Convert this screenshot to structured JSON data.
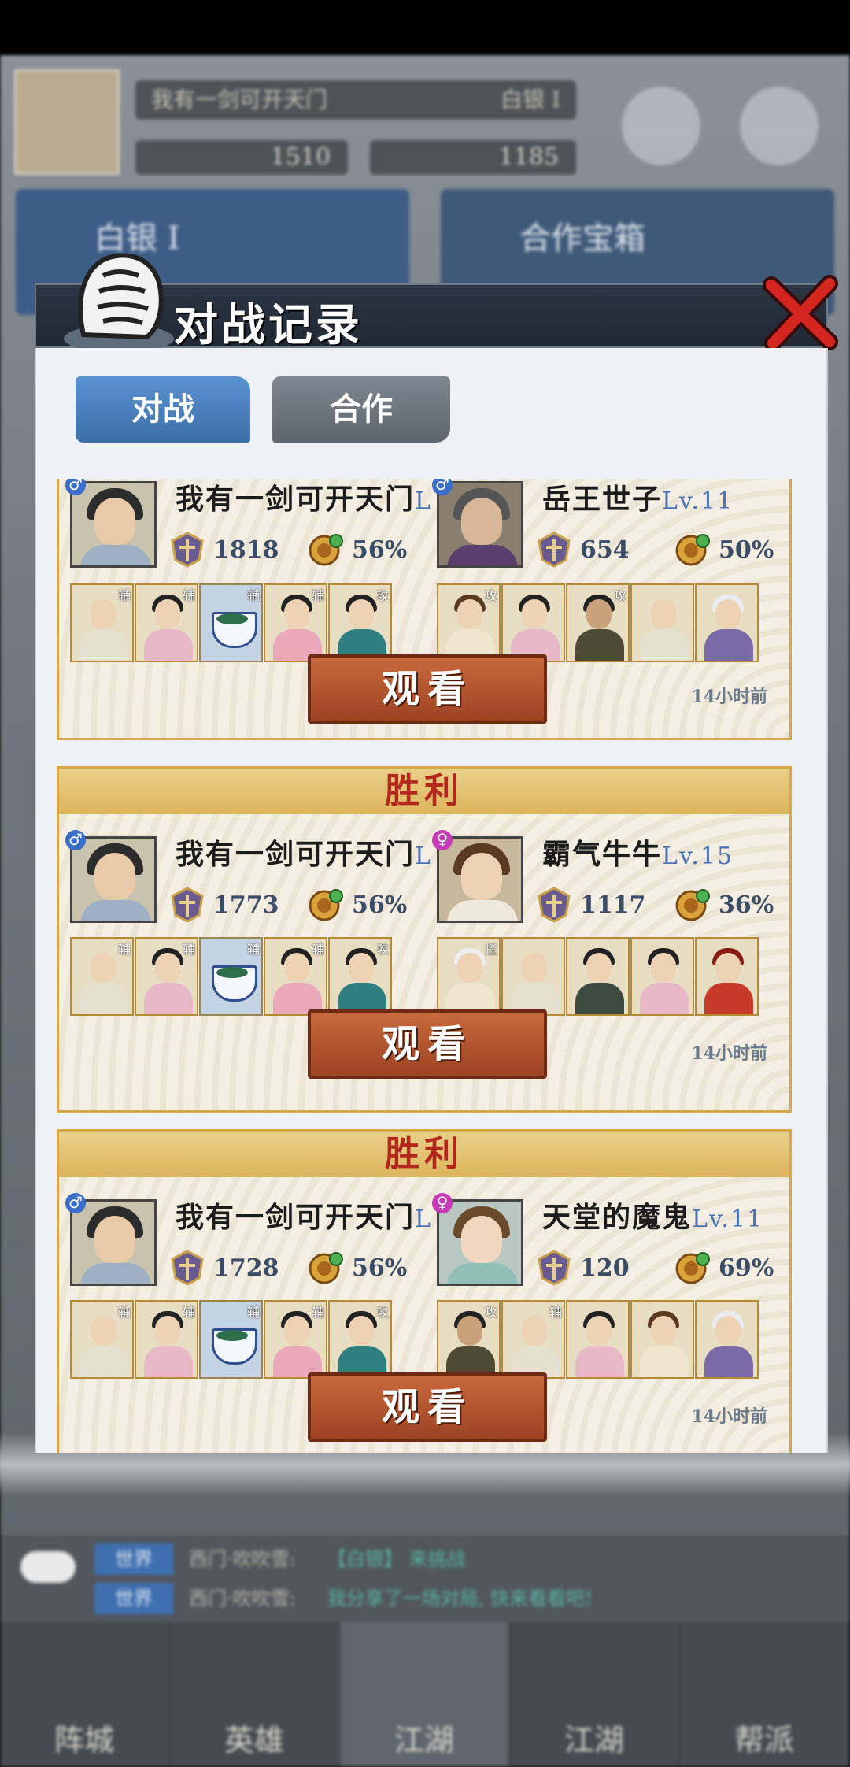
{
  "background": {
    "player_name": "我有一剑可开天门",
    "rank_label": "白银 I",
    "stat_left": "1510",
    "stat_right": "1185",
    "left_panel_title": "白银 I",
    "right_panel_title": "合作宝箱",
    "chat": [
      {
        "tag": "世界",
        "text": "西门·吹吹雪:",
        "extra": "【白银】 来挑战"
      },
      {
        "tag": "世界",
        "text": "西门·吹吹雪:",
        "extra": "我分享了一场对局, 快来看看吧!"
      }
    ],
    "nav": [
      "阵城",
      "英雄",
      "江湖",
      "江湖",
      "帮派"
    ]
  },
  "modal": {
    "title": "对战记录",
    "tabs": [
      "对战",
      "合作"
    ],
    "records": [
      {
        "result": "",
        "left": {
          "name": "我有一剑可开天门",
          "lv": "L",
          "gender": "♂",
          "power": "1818",
          "winrate": "56%",
          "heroes": [
            "辅",
            "辅",
            "辅",
            "辅",
            "攻"
          ]
        },
        "right": {
          "name": "岳王世子",
          "lv": "Lv.11",
          "gender": "♂",
          "power": "654",
          "winrate": "50%",
          "heroes": [
            "攻",
            "",
            "攻",
            "",
            ""
          ]
        },
        "watch": "观看",
        "time": "14小时前"
      },
      {
        "result": "胜利",
        "left": {
          "name": "我有一剑可开天门",
          "lv": "L",
          "gender": "♂",
          "power": "1773",
          "winrate": "56%",
          "heroes": [
            "辅",
            "辅",
            "辅",
            "辅",
            "攻"
          ]
        },
        "right": {
          "name": "霸气牛牛",
          "lv": "Lv.15",
          "gender": "♀",
          "power": "1117",
          "winrate": "36%",
          "heroes": [
            "控",
            "",
            "",
            "",
            ""
          ]
        },
        "watch": "观看",
        "time": "14小时前"
      },
      {
        "result": "胜利",
        "left": {
          "name": "我有一剑可开天门",
          "lv": "L",
          "gender": "♂",
          "power": "1728",
          "winrate": "56%",
          "heroes": [
            "辅",
            "辅",
            "辅",
            "辅",
            "攻"
          ]
        },
        "right": {
          "name": "天堂的魔鬼",
          "lv": "Lv.11",
          "gender": "♀",
          "power": "120",
          "winrate": "69%",
          "heroes": [
            "攻",
            "辅",
            "",
            "",
            ""
          ]
        },
        "watch": "观看",
        "time": "14小时前"
      }
    ]
  },
  "colors": {
    "banner_red": "#b3281c",
    "card_border": "#d6a84c",
    "watch_button": "#b5562f",
    "tab_active": "#4a82c0",
    "tab_inactive": "#6e767e",
    "level_blue": "#4a72b8"
  },
  "icons": [
    "logo-fist-icon",
    "close-x-icon",
    "rank-badge-icon",
    "winrate-coin-icon",
    "male-icon",
    "female-icon",
    "chat-bubble-icon"
  ]
}
